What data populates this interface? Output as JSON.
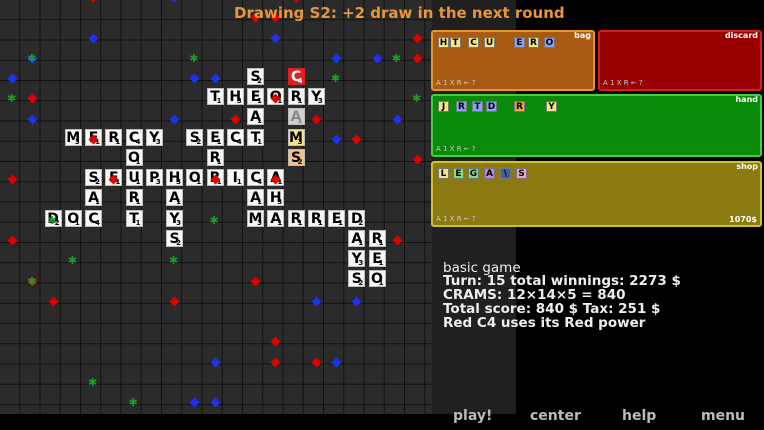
{
  "banner": "Drawing S2: +2 draw in the next round",
  "board": {
    "tiles": [
      {
        "l": "S",
        "v": "2",
        "c": 12,
        "r": 3
      },
      {
        "l": "C",
        "v": "4",
        "c": 14,
        "r": 3,
        "s": "red"
      },
      {
        "l": "T",
        "v": "1",
        "c": 10,
        "r": 4
      },
      {
        "l": "H",
        "v": "3",
        "c": 11,
        "r": 4
      },
      {
        "l": "E",
        "v": "1",
        "c": 12,
        "r": 4
      },
      {
        "l": "O",
        "v": "1",
        "c": 13,
        "r": 4
      },
      {
        "l": "R",
        "v": "1",
        "c": 14,
        "r": 4
      },
      {
        "l": "Y",
        "v": "3",
        "c": 15,
        "r": 4
      },
      {
        "l": "A",
        "v": "1",
        "c": 12,
        "r": 5
      },
      {
        "l": "A",
        "v": "1",
        "c": 14,
        "r": 5,
        "s": "gray"
      },
      {
        "l": "M",
        "v": "3",
        "c": 3,
        "r": 6
      },
      {
        "l": "E",
        "v": "1",
        "c": 4,
        "r": 6
      },
      {
        "l": "R",
        "v": "1",
        "c": 5,
        "r": 6
      },
      {
        "l": "C",
        "v": "4",
        "c": 6,
        "r": 6
      },
      {
        "l": "Y",
        "v": "3",
        "c": 7,
        "r": 6
      },
      {
        "l": "S",
        "v": "2",
        "c": 9,
        "r": 6
      },
      {
        "l": "E",
        "v": "1",
        "c": 10,
        "r": 6
      },
      {
        "l": "C",
        "v": "4",
        "c": 11,
        "r": 6
      },
      {
        "l": "T",
        "v": "1",
        "c": 12,
        "r": 6
      },
      {
        "l": "M",
        "v": "3",
        "c": 14,
        "r": 6,
        "s": "yellow"
      },
      {
        "l": "O",
        "v": "1",
        "c": 6,
        "r": 7
      },
      {
        "l": "R",
        "v": "1",
        "c": 10,
        "r": 7
      },
      {
        "l": "S",
        "v": "2",
        "c": 14,
        "r": 7,
        "s": "peach"
      },
      {
        "l": "S",
        "v": "2",
        "c": 4,
        "r": 8
      },
      {
        "l": "E",
        "v": "1",
        "c": 5,
        "r": 8
      },
      {
        "l": "U",
        "v": "1",
        "c": 6,
        "r": 8
      },
      {
        "l": "P",
        "v": "3",
        "c": 7,
        "r": 8
      },
      {
        "l": "H",
        "v": "3",
        "c": 8,
        "r": 8
      },
      {
        "l": "O",
        "v": "1",
        "c": 9,
        "r": 8
      },
      {
        "l": "R",
        "v": "1",
        "c": 10,
        "r": 8
      },
      {
        "l": "I",
        "v": "1",
        "c": 11,
        "r": 8
      },
      {
        "l": "C",
        "v": "4",
        "c": 12,
        "r": 8
      },
      {
        "l": "A",
        "v": "1",
        "c": 13,
        "r": 8
      },
      {
        "l": "A",
        "v": "1",
        "c": 4,
        "r": 9
      },
      {
        "l": "R",
        "v": "1",
        "c": 6,
        "r": 9
      },
      {
        "l": "A",
        "v": "1",
        "c": 8,
        "r": 9
      },
      {
        "l": "A",
        "v": "1",
        "c": 12,
        "r": 9
      },
      {
        "l": "H",
        "v": "3",
        "c": 13,
        "r": 9
      },
      {
        "l": "D",
        "v": "2",
        "c": 2,
        "r": 10
      },
      {
        "l": "O",
        "v": "1",
        "c": 3,
        "r": 10
      },
      {
        "l": "C",
        "v": "4",
        "c": 4,
        "r": 10
      },
      {
        "l": "T",
        "v": "1",
        "c": 6,
        "r": 10
      },
      {
        "l": "Y",
        "v": "3",
        "c": 8,
        "r": 10
      },
      {
        "l": "M",
        "v": "3",
        "c": 12,
        "r": 10
      },
      {
        "l": "A",
        "v": "1",
        "c": 13,
        "r": 10
      },
      {
        "l": "R",
        "v": "1",
        "c": 14,
        "r": 10
      },
      {
        "l": "R",
        "v": "1",
        "c": 15,
        "r": 10
      },
      {
        "l": "E",
        "v": "1",
        "c": 16,
        "r": 10
      },
      {
        "l": "D",
        "v": "2",
        "c": 17,
        "r": 10
      },
      {
        "l": "S",
        "v": "2",
        "c": 8,
        "r": 11
      },
      {
        "l": "A",
        "v": "1",
        "c": 17,
        "r": 11
      },
      {
        "l": "R",
        "v": "1",
        "c": 18,
        "r": 11
      },
      {
        "l": "Y",
        "v": "3",
        "c": 17,
        "r": 12
      },
      {
        "l": "E",
        "v": "1",
        "c": 18,
        "r": 12
      },
      {
        "l": "S",
        "v": "2",
        "c": 17,
        "r": 13
      },
      {
        "l": "O",
        "v": "1",
        "c": 18,
        "r": 13
      }
    ],
    "diamonds_red": [
      [
        4,
        0
      ],
      [
        13,
        1
      ],
      [
        12,
        1
      ],
      [
        14,
        0
      ],
      [
        1,
        5
      ],
      [
        13,
        5
      ],
      [
        4,
        7
      ],
      [
        11,
        6
      ],
      [
        20,
        3
      ],
      [
        20,
        2
      ],
      [
        0,
        9
      ],
      [
        5,
        9
      ],
      [
        10,
        9
      ],
      [
        13,
        9
      ],
      [
        0,
        12
      ],
      [
        1,
        14
      ],
      [
        19,
        12
      ],
      [
        12,
        14
      ],
      [
        2,
        15
      ],
      [
        8,
        15
      ],
      [
        13,
        18
      ],
      [
        15,
        18
      ],
      [
        13,
        17
      ],
      [
        15,
        6
      ],
      [
        17,
        7
      ],
      [
        20,
        8
      ]
    ],
    "diamonds_blue": [
      [
        8,
        0
      ],
      [
        4,
        2
      ],
      [
        10,
        4
      ],
      [
        13,
        2
      ],
      [
        16,
        3
      ],
      [
        18,
        3
      ],
      [
        1,
        3
      ],
      [
        0,
        4
      ],
      [
        9,
        4
      ],
      [
        16,
        7
      ],
      [
        19,
        6
      ],
      [
        1,
        6
      ],
      [
        15,
        15
      ],
      [
        17,
        15
      ],
      [
        10,
        18
      ],
      [
        16,
        18
      ],
      [
        9,
        20
      ],
      [
        10,
        20
      ],
      [
        8,
        6
      ]
    ],
    "stars": [
      [
        1,
        3
      ],
      [
        9,
        3
      ],
      [
        16,
        4
      ],
      [
        1,
        14
      ],
      [
        2,
        11
      ],
      [
        8,
        13
      ],
      [
        4,
        19
      ],
      [
        6,
        20
      ],
      [
        20,
        5
      ],
      [
        0,
        5
      ],
      [
        19,
        3
      ],
      [
        10,
        11
      ],
      [
        3,
        13
      ]
    ]
  },
  "panels": {
    "bag": {
      "tag": "bag",
      "foot": "A 1 X R ← ?",
      "tiles": [
        {
          "l": "H",
          "c": "#f1e48c"
        },
        {
          "l": "T",
          "c": "#f1e48c"
        },
        {
          "l": "C",
          "c": "#f1e48c"
        },
        {
          "l": "U",
          "c": "#f1e48c"
        },
        {
          "l": "E",
          "c": "#8aa0ff"
        },
        {
          "l": "R",
          "c": "#f1e48c"
        },
        {
          "l": "O",
          "c": "#8aa0ff"
        }
      ]
    },
    "discard": {
      "tag": "discard",
      "foot": "A 1 X R ← ?"
    },
    "hand": {
      "tag": "hand",
      "foot": "A 1 X R ← ?",
      "tiles": [
        {
          "l": "J",
          "c": "#f1e48c"
        },
        {
          "l": "R",
          "c": "#8aa0ff"
        },
        {
          "l": "T",
          "c": "#8aa0ff"
        },
        {
          "l": "D",
          "c": "#8aa0ff"
        },
        {
          "l": "R",
          "c": "#f0a040"
        },
        {
          "l": "Y",
          "c": "#f1e48c"
        }
      ]
    },
    "shop": {
      "tag": "shop",
      "foot": "A 1 X R ← ?",
      "price": "1070$",
      "tiles": [
        {
          "l": "L",
          "c": "#f1e48c"
        },
        {
          "l": "E",
          "c": "#80e080"
        },
        {
          "l": "G",
          "c": "#80e080"
        },
        {
          "l": "A",
          "c": "#c080f0"
        },
        {
          "l": "\\",
          "c": "#4060a0"
        },
        {
          "l": "S",
          "c": "#f0a0d0"
        }
      ]
    }
  },
  "info": {
    "line1": "basic game",
    "line2": "Turn: 15 total winnings: 2273 $",
    "line3": "CRAMS: 12×14×5 = 840",
    "line4": "Total score: 840 $ Tax: 251 $",
    "line5": "Red C4 uses its Red power"
  },
  "buttons": {
    "play": "play!",
    "center": "center",
    "help": "help",
    "menu": "menu"
  }
}
